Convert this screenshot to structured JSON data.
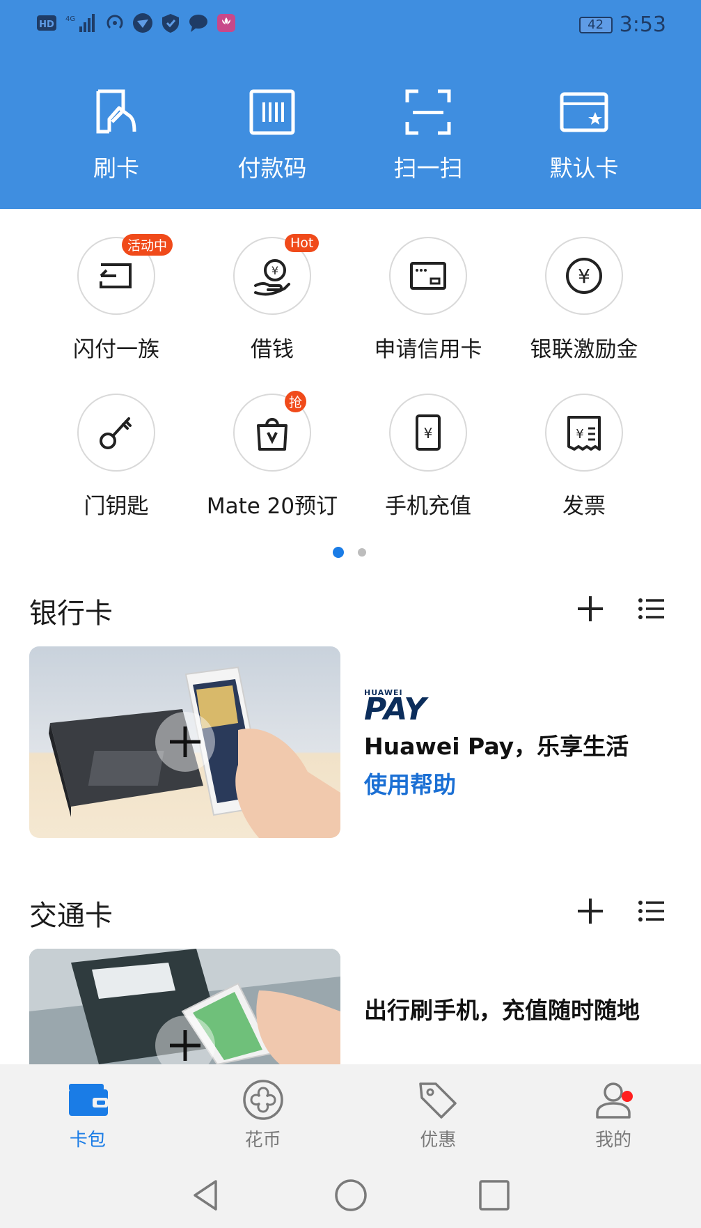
{
  "status_bar": {
    "left_icons": [
      "hd-icon",
      "signal-4g-icon",
      "hotspot-icon",
      "bird-icon",
      "shield-icon",
      "message-icon",
      "huawei-app-icon"
    ],
    "hd_label": "HD",
    "network_label": "4G",
    "battery_level": "42",
    "time": "3:53"
  },
  "quick_actions": [
    {
      "label": "刷卡",
      "icon": "card-tap-icon"
    },
    {
      "label": "付款码",
      "icon": "barcode-icon"
    },
    {
      "label": "扫一扫",
      "icon": "scan-icon"
    },
    {
      "label": "默认卡",
      "icon": "default-card-icon"
    }
  ],
  "services": {
    "row1": [
      {
        "label": "闪付一族",
        "badge": "活动中",
        "icon": "quickpass-icon"
      },
      {
        "label": "借钱",
        "badge": "Hot",
        "icon": "loan-icon"
      },
      {
        "label": "申请信用卡",
        "badge": "",
        "icon": "credit-card-icon"
      },
      {
        "label": "银联激励金",
        "badge": "",
        "icon": "yuan-coin-icon"
      }
    ],
    "row2": [
      {
        "label": "门钥匙",
        "badge": "",
        "icon": "key-icon"
      },
      {
        "label": "Mate 20预订",
        "badge": "抢",
        "icon": "shopping-bag-icon"
      },
      {
        "label": "手机充值",
        "badge": "",
        "icon": "phone-recharge-icon"
      },
      {
        "label": "发票",
        "badge": "",
        "icon": "invoice-icon"
      }
    ]
  },
  "pager": {
    "count": 2,
    "active": 0
  },
  "bank_card": {
    "title": "银行卡",
    "brand_small": "HUAWEI",
    "brand_large": "PAY",
    "slogan": "Huawei Pay，乐享生活",
    "help_link": "使用帮助"
  },
  "transit_card": {
    "title": "交通卡",
    "slogan": "出行刷手机，充值随时随地"
  },
  "bottom_tabs": [
    {
      "label": "卡包",
      "icon": "wallet-icon",
      "active": true
    },
    {
      "label": "花币",
      "icon": "flower-coin-icon",
      "active": false
    },
    {
      "label": "优惠",
      "icon": "tag-icon",
      "active": false
    },
    {
      "label": "我的",
      "icon": "person-icon",
      "active": false
    }
  ],
  "colors": {
    "header_blue": "#3f8ee0",
    "accent_blue": "#1a7ce6",
    "badge_red": "#f04a1a"
  }
}
